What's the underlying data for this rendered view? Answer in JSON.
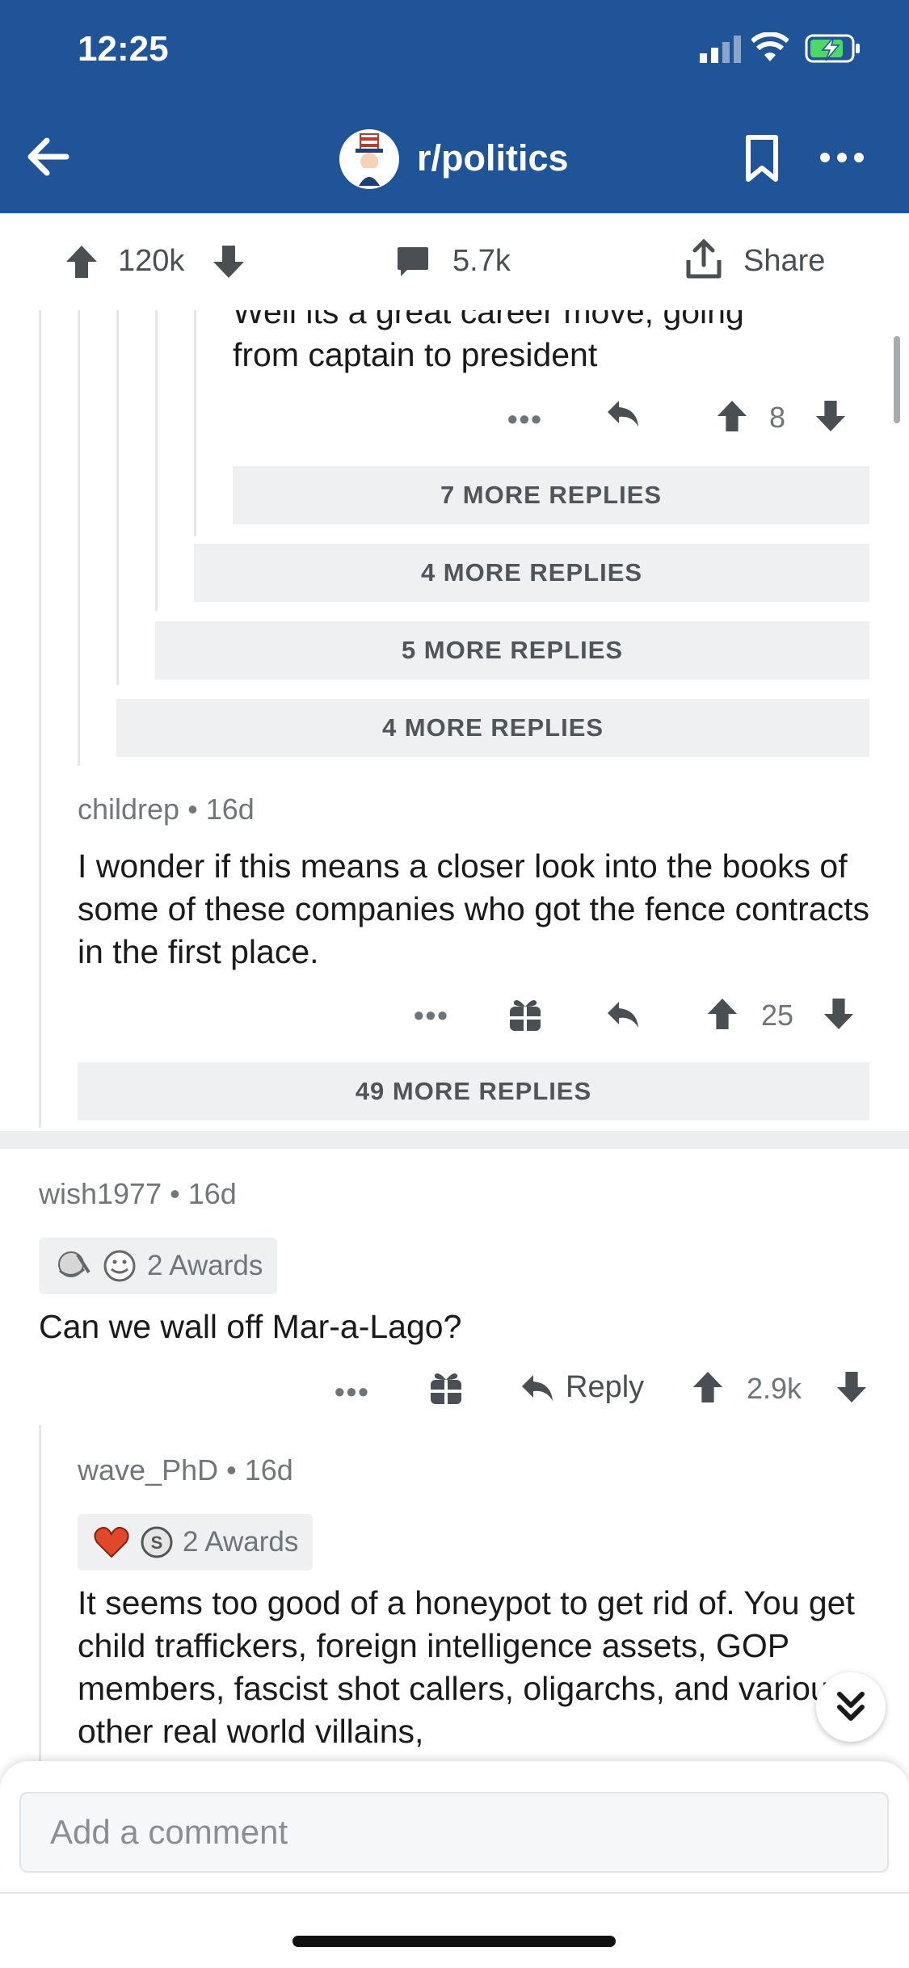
{
  "status_bar": {
    "time": "12:25"
  },
  "nav": {
    "subreddit": "r/politics"
  },
  "post_actions": {
    "upvotes": "120k",
    "comments": "5.7k",
    "share_label": "Share"
  },
  "top_comment": {
    "text_line1": "Well its a great career move, going",
    "text_line2": "from captain to president",
    "score": "8"
  },
  "more_replies": {
    "r1": "7 MORE REPLIES",
    "r2": "4 MORE REPLIES",
    "r3": "5 MORE REPLIES",
    "r4": "4 MORE REPLIES",
    "r5": "49 MORE REPLIES"
  },
  "childrep_comment": {
    "author": "childrep",
    "age": "16d",
    "text": "I wonder if this means a closer look into the books of some of these companies who got the fence contracts in the first place.",
    "score": "25"
  },
  "wish_comment": {
    "author": "wish1977",
    "age": "16d",
    "awards": "2 Awards",
    "text": "Can we wall off Mar-a-Lago?",
    "reply_label": "Reply",
    "score": "2.9k"
  },
  "wave_comment": {
    "author": "wave_PhD",
    "age": "16d",
    "awards": "2 Awards",
    "text": "It seems too good of a honeypot to get rid of. You get child traffickers, foreign intelligence assets, GOP members, fascist shot callers, oligarchs, and various other real world villains,"
  },
  "composer": {
    "placeholder": "Add a comment"
  },
  "colors": {
    "header": "#1f5499",
    "text": "#1a1a1b",
    "muted": "#6f7478",
    "panel": "#eef0f2"
  }
}
